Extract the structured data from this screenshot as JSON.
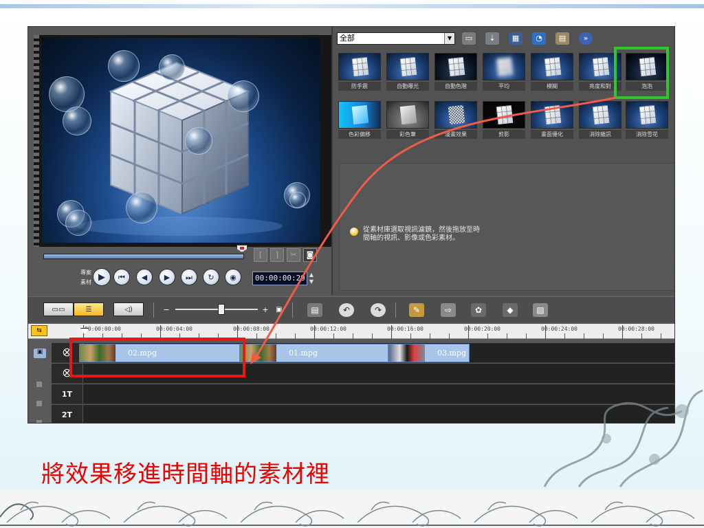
{
  "library": {
    "category": "全部",
    "effects_row1": [
      "防手震",
      "自動曝光",
      "自動色階",
      "平均",
      "模糊",
      "亮度和對",
      "泡泡"
    ],
    "effects_row2": [
      "色彩偏移",
      "彩色筆",
      "漫畫效果",
      "剪影",
      "畫面優化",
      "消除雜訊",
      "消除雪花"
    ],
    "selected_effect": "泡泡",
    "hint": "從素材庫選取視訊濾鏡，然後拖放至時間軸的視訊、影像或色彩素材。"
  },
  "player": {
    "project_label": "專案",
    "clip_label": "素材",
    "timecode": "00:00:00:29"
  },
  "timeline": {
    "ruler_labels": [
      "00:00:00:00",
      "00:00:04:00",
      "00:00:08:00",
      "00:00:12:00",
      "00:00:16:00",
      "00:00:20:00",
      "00:00:24:00",
      "00:00:28:00"
    ],
    "clips": [
      "02.mpg",
      "01.mpg",
      "03.mpg"
    ],
    "track_labels": [
      "1T",
      "2T"
    ]
  },
  "slide": {
    "caption": "將效果移進時間軸的素材裡"
  },
  "colors": {
    "highlight_red": "#e81818",
    "highlight_green": "#2ec82e",
    "caption_red": "#ee0000"
  }
}
